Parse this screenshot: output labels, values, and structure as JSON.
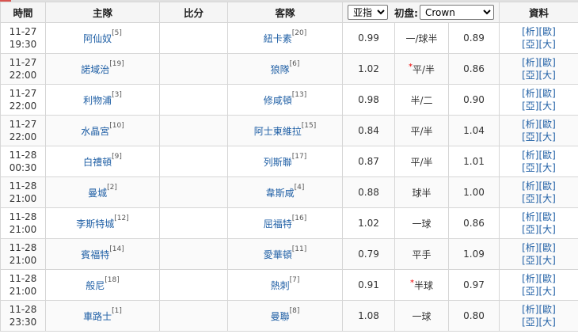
{
  "header": {
    "time": "時間",
    "home": "主隊",
    "score": "比分",
    "away": "客隊",
    "odds_type": "亚指",
    "odds_type_options": [
      "亚指"
    ],
    "initial_label": "初盘:",
    "company": "Crown",
    "company_options": [
      "Crown"
    ],
    "info": "資料"
  },
  "rows": [
    {
      "date": "11-27",
      "clock": "19:30",
      "home": "阿仙奴",
      "home_rank": "[5]",
      "score": "",
      "away": "紐卡素",
      "away_rank": "[20]",
      "home_odds": "0.99",
      "star": "",
      "handicap": "一/球半",
      "away_odds": "0.89"
    },
    {
      "date": "11-27",
      "clock": "22:00",
      "home": "諾域治",
      "home_rank": "[19]",
      "score": "",
      "away": "狼隊",
      "away_rank": "[6]",
      "home_odds": "1.02",
      "star": "*",
      "handicap": "平/半",
      "away_odds": "0.86"
    },
    {
      "date": "11-27",
      "clock": "22:00",
      "home": "利物浦",
      "home_rank": "[3]",
      "score": "",
      "away": "修咸頓",
      "away_rank": "[13]",
      "home_odds": "0.98",
      "star": "",
      "handicap": "半/二",
      "away_odds": "0.90"
    },
    {
      "date": "11-27",
      "clock": "22:00",
      "home": "水晶宮",
      "home_rank": "[10]",
      "score": "",
      "away": "阿士東維拉",
      "away_rank": "[15]",
      "home_odds": "0.84",
      "star": "",
      "handicap": "平/半",
      "away_odds": "1.04"
    },
    {
      "date": "11-28",
      "clock": "00:30",
      "home": "白禮頓",
      "home_rank": "[9]",
      "score": "",
      "away": "列斯聯",
      "away_rank": "[17]",
      "home_odds": "0.87",
      "star": "",
      "handicap": "平/半",
      "away_odds": "1.01"
    },
    {
      "date": "11-28",
      "clock": "21:00",
      "home": "曼城",
      "home_rank": "[2]",
      "score": "",
      "away": "韋斯咸",
      "away_rank": "[4]",
      "home_odds": "0.88",
      "star": "",
      "handicap": "球半",
      "away_odds": "1.00"
    },
    {
      "date": "11-28",
      "clock": "21:00",
      "home": "李斯特城",
      "home_rank": "[12]",
      "score": "",
      "away": "屈福特",
      "away_rank": "[16]",
      "home_odds": "1.02",
      "star": "",
      "handicap": "一球",
      "away_odds": "0.86"
    },
    {
      "date": "11-28",
      "clock": "21:00",
      "home": "賓福特",
      "home_rank": "[14]",
      "score": "",
      "away": "愛華頓",
      "away_rank": "[11]",
      "home_odds": "0.79",
      "star": "",
      "handicap": "平手",
      "away_odds": "1.09"
    },
    {
      "date": "11-28",
      "clock": "21:00",
      "home": "般尼",
      "home_rank": "[18]",
      "score": "",
      "away": "熱刺",
      "away_rank": "[7]",
      "home_odds": "0.91",
      "star": "*",
      "handicap": "半球",
      "away_odds": "0.97"
    },
    {
      "date": "11-28",
      "clock": "23:30",
      "home": "車路士",
      "home_rank": "[1]",
      "score": "",
      "away": "曼聯",
      "away_rank": "[8]",
      "home_odds": "1.08",
      "star": "",
      "handicap": "一球",
      "away_odds": "0.80"
    }
  ],
  "links": {
    "analysis": "[析]",
    "europe": "[歐]",
    "asia": "[亞]",
    "bigsmall": "[大]"
  }
}
